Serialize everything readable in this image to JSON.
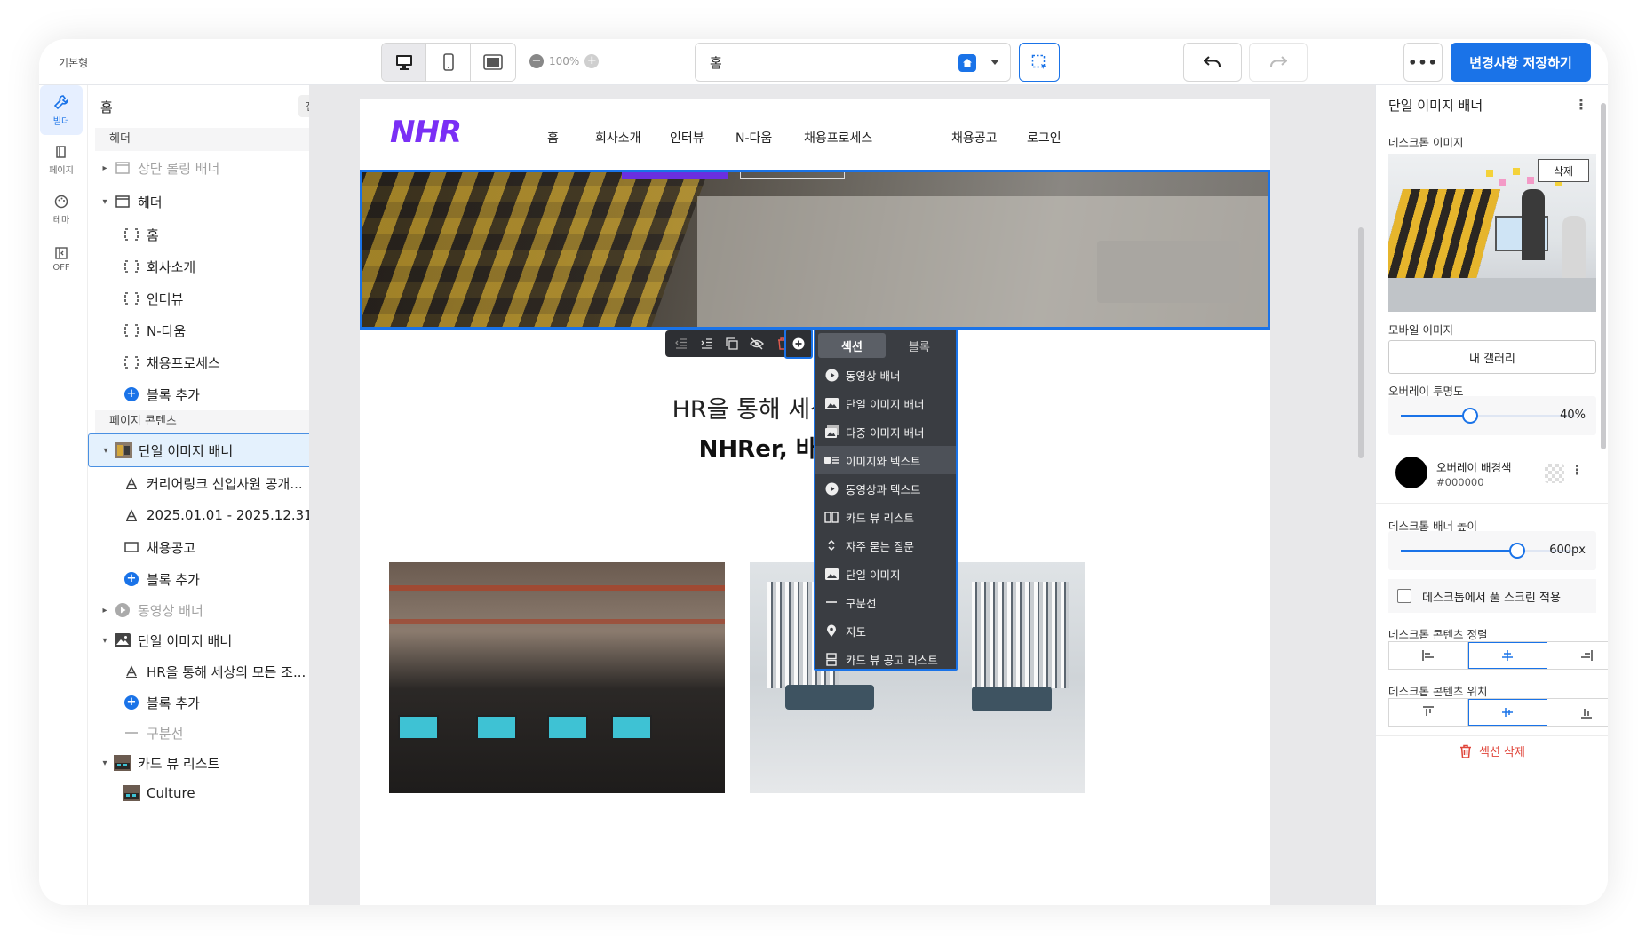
{
  "topbar": {
    "theme_label": "기본형",
    "zoom": "100%",
    "page_select_value": "홈",
    "save_label": "변경사항 저장하기"
  },
  "rail": {
    "items": [
      {
        "label": "빌더",
        "icon": "wrench-icon"
      },
      {
        "label": "페이지",
        "icon": "book-icon"
      },
      {
        "label": "테마",
        "icon": "palette-icon"
      },
      {
        "label": "OFF",
        "icon": "panel-toggle-icon"
      }
    ]
  },
  "tree": {
    "title": "홈",
    "collapse_all": "전체접기",
    "header_section": "헤더",
    "content_section": "페이지 콘텐츠",
    "rows": {
      "top_rolling_banner": "상단 롤링 배너",
      "header": "헤더",
      "nav_home": "홈",
      "nav_company": "회사소개",
      "nav_interview": "인터뷰",
      "nav_ndaum": "N-다움",
      "nav_process": "채용프로세스",
      "add_block_1": "블록 추가",
      "single_image_banner_1": "단일 이미지 배너",
      "career_text": "커리어링크 신입사원 공개...",
      "date_text": "2025.01.01 - 2025.12.31",
      "recruit_button": "채용공고",
      "add_block_2": "블록 추가",
      "video_banner": "동영상 배너",
      "single_image_banner_2": "단일 이미지 배너",
      "hr_text": "HR을 통해 세상의 모든 조...",
      "add_block_3": "블록 추가",
      "divider": "구분선",
      "card_view_list": "카드 뷰 리스트",
      "culture": "Culture"
    }
  },
  "site": {
    "brand": "NHR",
    "nav": [
      "홈",
      "회사소개",
      "인터뷰",
      "N-다움",
      "채용프로세스"
    ],
    "nav_right": [
      "채용공고",
      "로그인"
    ],
    "headline1": "HR을 통해 세상의 모든 조직",
    "headline2": "NHRer, 바로 여러분입"
  },
  "add_menu": {
    "tabs": [
      "섹션",
      "블록"
    ],
    "items": [
      {
        "label": "동영상 배너",
        "icon": "play-circle-icon"
      },
      {
        "label": "단일 이미지 배너",
        "icon": "image-icon"
      },
      {
        "label": "다중 이미지 배너",
        "icon": "images-icon"
      },
      {
        "label": "이미지와 텍스트",
        "icon": "image-text-icon"
      },
      {
        "label": "동영상과 텍스트",
        "icon": "play-circle-icon"
      },
      {
        "label": "카드 뷰 리스트",
        "icon": "card-columns-icon"
      },
      {
        "label": "자주 묻는 질문",
        "icon": "expand-icon"
      },
      {
        "label": "단일 이미지",
        "icon": "image-icon"
      },
      {
        "label": "구분선",
        "icon": "divider-icon"
      },
      {
        "label": "지도",
        "icon": "map-pin-icon"
      },
      {
        "label": "카드 뷰 공고 리스트",
        "icon": "card-list-icon"
      }
    ]
  },
  "props": {
    "title": "단일 이미지 배너",
    "desktop_image_label": "데스크톱 이미지",
    "delete_label": "삭제",
    "mobile_image_label": "모바일 이미지",
    "gallery_label": "내 갤러리",
    "overlay_opacity_label": "오버레이 투명도",
    "overlay_opacity_value": "40%",
    "overlay_opacity_fraction": 0.4,
    "overlay_color_label": "오버레이 배경색",
    "overlay_color_hex": "#000000",
    "banner_height_label": "데스크톱 배너 높이",
    "banner_height_value": "600px",
    "banner_height_fraction": 0.67,
    "fullscreen_label": "데스크톱에서 풀 스크린 적용",
    "align_label": "데스크톱 콘텐츠 정렬",
    "position_label": "데스크톱 콘텐츠 위치",
    "delete_section_label": "섹션 삭제"
  },
  "colors": {
    "accent": "#1a73e8",
    "brand": "#7a2ff5",
    "danger": "#e0453a"
  }
}
